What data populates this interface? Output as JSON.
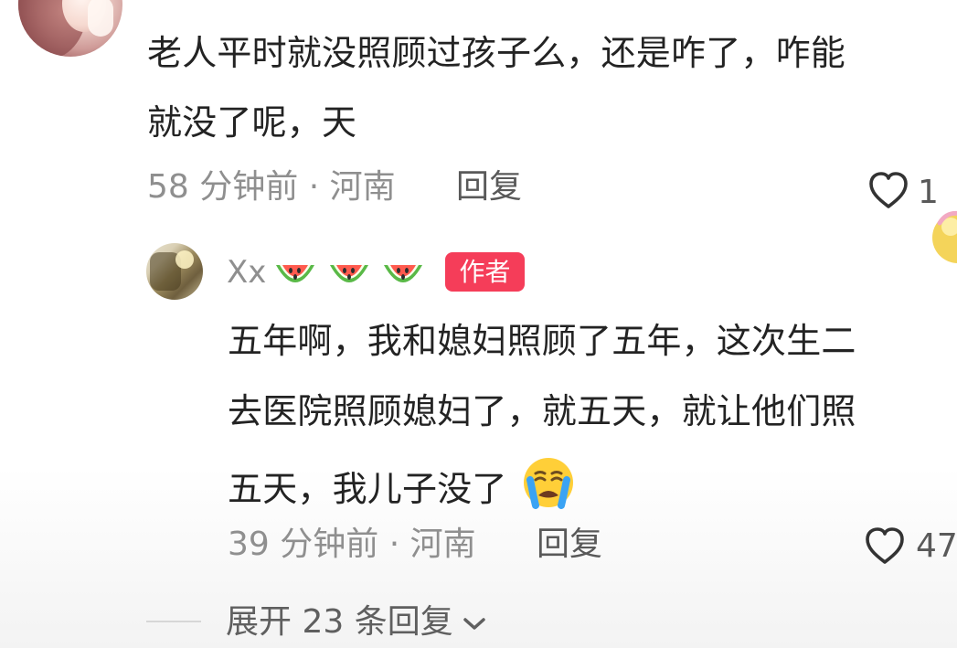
{
  "comment": {
    "text_line1": "老人平时就没照顾过孩子么，还是咋了，咋能",
    "text_line2": "就没了呢，天",
    "time": "58 分钟前",
    "separator": " · ",
    "location": "河南",
    "reply_label": "回复",
    "likes": "1",
    "avatar_icon": "avatar-portrait"
  },
  "reply": {
    "username": "Xx",
    "username_emojis": [
      "watermelon-icon",
      "watermelon-icon",
      "watermelon-icon"
    ],
    "badge": "作者",
    "text_line1": "五年啊，我和媳妇照顾了五年，这次生二",
    "text_line2": "去医院照顾媳妇了，就五天，就让他们照",
    "text_line3": "五天，我儿子没了",
    "emoji": "crying-face-icon",
    "time": "39 分钟前",
    "separator": " · ",
    "location": "河南",
    "reply_label": "回复",
    "likes": "47",
    "avatar_icon": "avatar-photo"
  },
  "expand": {
    "label": "展开 23 条回复",
    "icon": "chevron-down-icon"
  },
  "colors": {
    "text": "#232323",
    "meta": "#8f8f8f",
    "badge_bg": "#f53d59",
    "badge_text": "#ffffff",
    "heart": "#333333"
  }
}
